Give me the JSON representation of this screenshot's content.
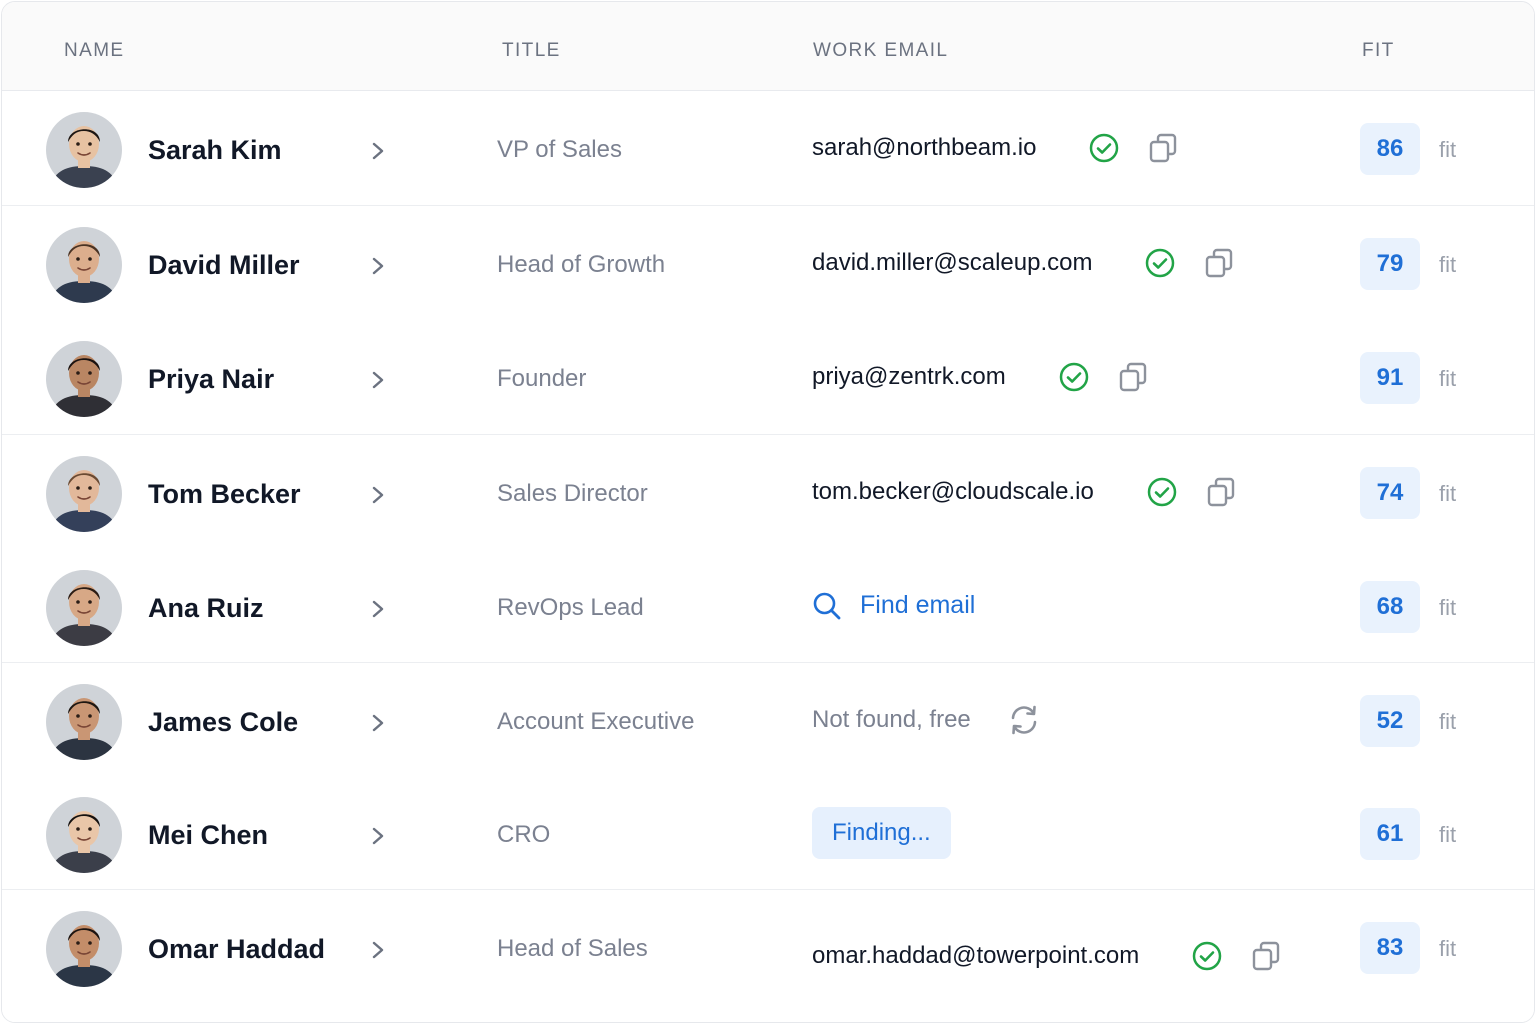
{
  "columns": {
    "name": "NAME",
    "title": "TITLE",
    "work_email": "WORK EMAIL",
    "fit": "FIT"
  },
  "fit_suffix": "fit",
  "status_colors": {
    "verified": "#22a447",
    "link": "#1f6fd6",
    "badge_bg": "#e9f2fd"
  },
  "rows": [
    {
      "name": "Sarah Kim",
      "title": "VP of Sales",
      "email_state": "verified",
      "email": "sarah@northbeam.io",
      "fit": "86",
      "avatar": {
        "skin": "#e7c2a2",
        "hair": "#1d1613",
        "shirt": "#3a4150"
      }
    },
    {
      "name": "David Miller",
      "title": "Head of Growth",
      "email_state": "verified",
      "email": "david.miller@scaleup.com",
      "fit": "79",
      "avatar": {
        "skin": "#dcae8d",
        "hair": "#4a3324",
        "shirt": "#2e3a4e"
      }
    },
    {
      "name": "Priya Nair",
      "title": "Founder",
      "email_state": "verified",
      "email": "priya@zentrk.com",
      "fit": "91",
      "avatar": {
        "skin": "#b98663",
        "hair": "#1a1210",
        "shirt": "#2f2f35"
      }
    },
    {
      "name": "Tom Becker",
      "title": "Sales Director",
      "email_state": "verified",
      "email": "tom.becker@cloudscale.io",
      "fit": "74",
      "avatar": {
        "skin": "#e2b89a",
        "hair": "#6a4a33",
        "shirt": "#34405a"
      }
    },
    {
      "name": "Ana Ruiz",
      "title": "RevOps Lead",
      "email_state": "find",
      "find_label": "Find email",
      "fit": "68",
      "avatar": {
        "skin": "#d7a886",
        "hair": "#2b1c14",
        "shirt": "#3c3c44"
      }
    },
    {
      "name": "James Cole",
      "title": "Account Executive",
      "email_state": "notfound",
      "status_text": "Not found, free",
      "fit": "52",
      "avatar": {
        "skin": "#c99674",
        "hair": "#1e1712",
        "shirt": "#2c3441"
      }
    },
    {
      "name": "Mei Chen",
      "title": "CRO",
      "email_state": "finding",
      "status_text": "Finding...",
      "fit": "61",
      "avatar": {
        "skin": "#e9c6a8",
        "hair": "#15110f",
        "shirt": "#3b3f4a"
      }
    },
    {
      "name": "Omar Haddad",
      "title": "Head of Sales",
      "email_state": "verified",
      "email": "omar.haddad@towerpoint.com",
      "fit": "83",
      "avatar": {
        "skin": "#c38d69",
        "hair": "#1c1411",
        "shirt": "#2b3646"
      }
    }
  ]
}
